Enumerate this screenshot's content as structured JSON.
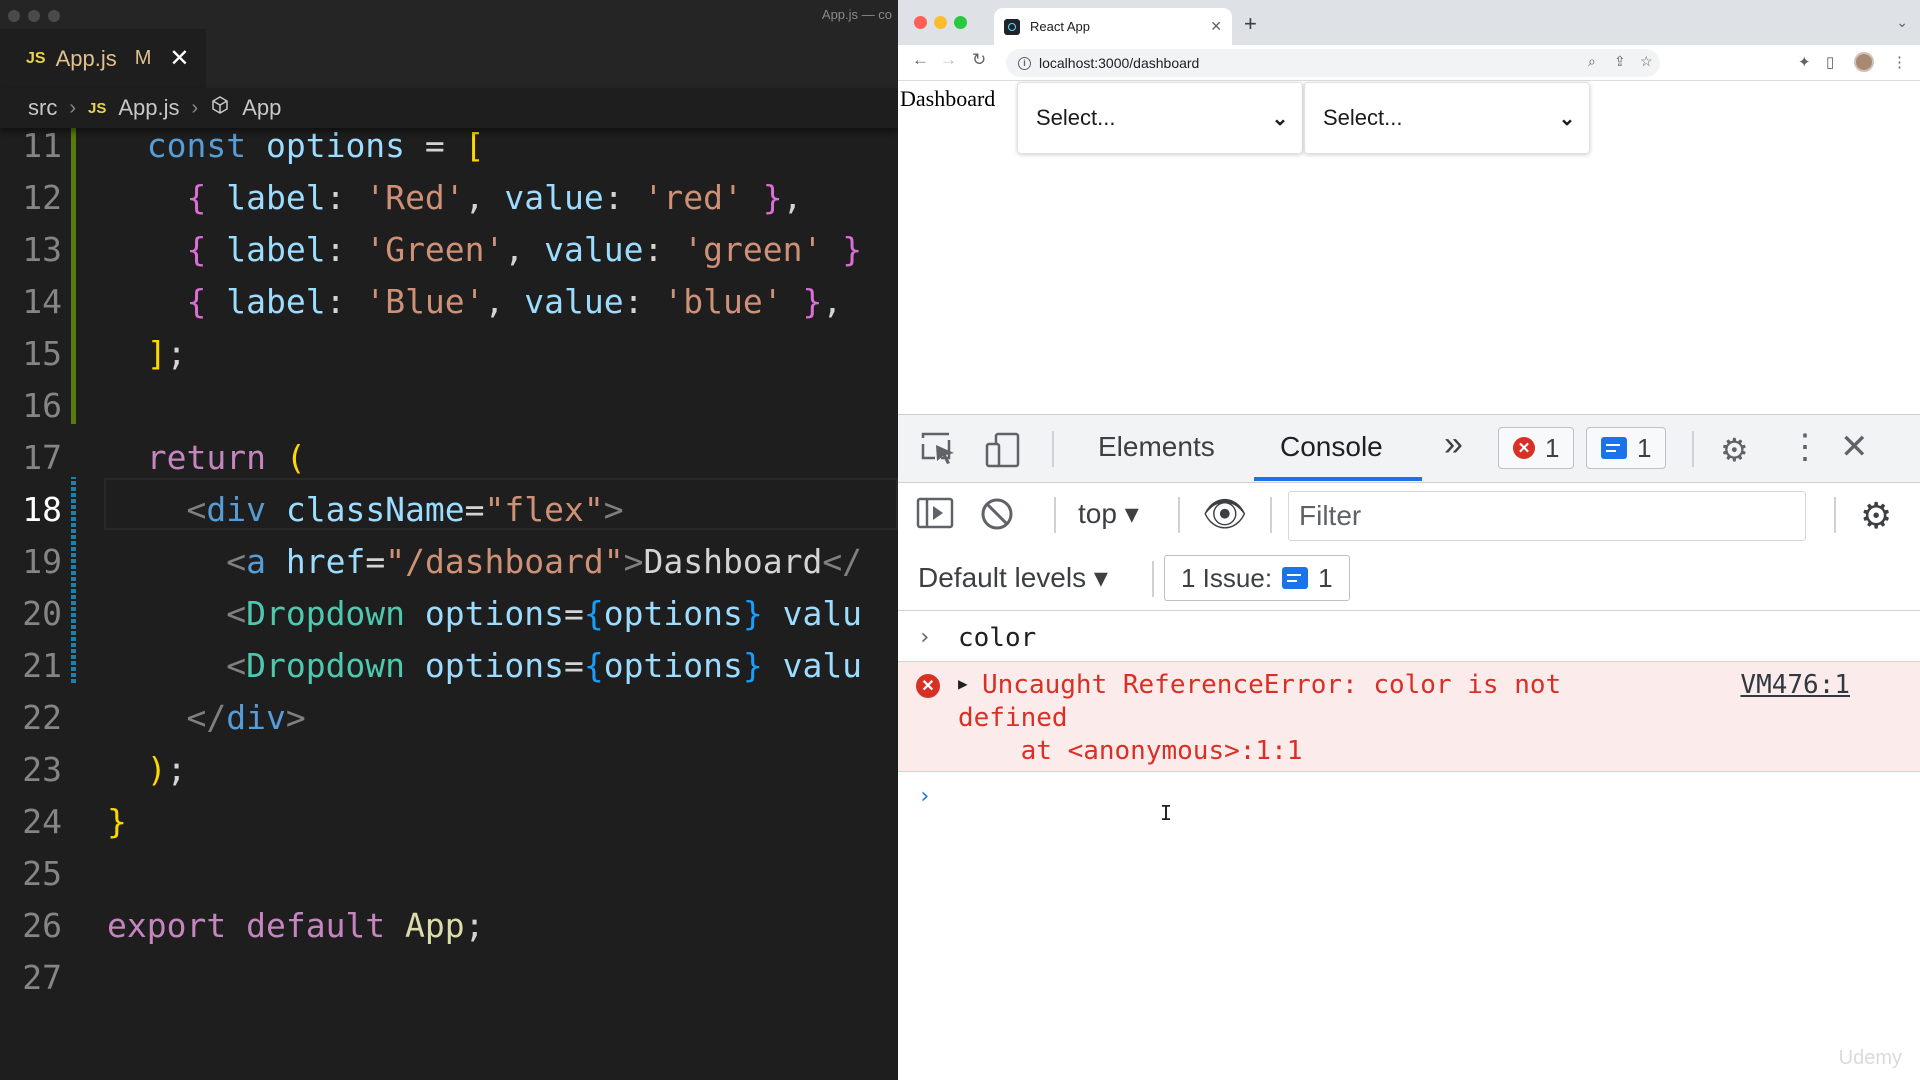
{
  "editor": {
    "window_title": "App.js — co",
    "tab": {
      "badge": "JS",
      "filename": "App.js",
      "status": "M",
      "close": "✕"
    },
    "breadcrumbs": {
      "folder": "src",
      "file_badge": "JS",
      "file": "App.js",
      "symbol": "App"
    },
    "current_line": 18,
    "lines": [
      {
        "n": "11",
        "parts": [
          [
            "p",
            "  "
          ],
          [
            "kb",
            "const"
          ],
          [
            "p",
            " "
          ],
          [
            "v",
            "options"
          ],
          [
            "p",
            " = "
          ],
          [
            "b1",
            "["
          ]
        ]
      },
      {
        "n": "12",
        "parts": [
          [
            "p",
            "    "
          ],
          [
            "b2",
            "{"
          ],
          [
            "p",
            " "
          ],
          [
            "v",
            "label"
          ],
          [
            "p",
            ": "
          ],
          [
            "s",
            "'Red'"
          ],
          [
            "p",
            ", "
          ],
          [
            "v",
            "value"
          ],
          [
            "p",
            ": "
          ],
          [
            "s",
            "'red'"
          ],
          [
            "p",
            " "
          ],
          [
            "b2",
            "}"
          ],
          [
            "p",
            ","
          ]
        ]
      },
      {
        "n": "13",
        "parts": [
          [
            "p",
            "    "
          ],
          [
            "b2",
            "{"
          ],
          [
            "p",
            " "
          ],
          [
            "v",
            "label"
          ],
          [
            "p",
            ": "
          ],
          [
            "s",
            "'Green'"
          ],
          [
            "p",
            ", "
          ],
          [
            "v",
            "value"
          ],
          [
            "p",
            ": "
          ],
          [
            "s",
            "'green'"
          ],
          [
            "p",
            " "
          ],
          [
            "b2",
            "}"
          ]
        ]
      },
      {
        "n": "14",
        "parts": [
          [
            "p",
            "    "
          ],
          [
            "b2",
            "{"
          ],
          [
            "p",
            " "
          ],
          [
            "v",
            "label"
          ],
          [
            "p",
            ": "
          ],
          [
            "s",
            "'Blue'"
          ],
          [
            "p",
            ", "
          ],
          [
            "v",
            "value"
          ],
          [
            "p",
            ": "
          ],
          [
            "s",
            "'blue'"
          ],
          [
            "p",
            " "
          ],
          [
            "b2",
            "}"
          ],
          [
            "p",
            ","
          ]
        ]
      },
      {
        "n": "15",
        "parts": [
          [
            "p",
            "  "
          ],
          [
            "b1",
            "]"
          ],
          [
            "p",
            ";"
          ]
        ]
      },
      {
        "n": "16",
        "parts": []
      },
      {
        "n": "17",
        "parts": [
          [
            "p",
            "  "
          ],
          [
            "k",
            "return"
          ],
          [
            "p",
            " "
          ],
          [
            "b1",
            "("
          ]
        ]
      },
      {
        "n": "18",
        "parts": [
          [
            "p",
            "    "
          ],
          [
            "tg",
            "<"
          ],
          [
            "tag",
            "div"
          ],
          [
            "p",
            " "
          ],
          [
            "attr",
            "className"
          ],
          [
            "p",
            "="
          ],
          [
            "s",
            "\"flex\""
          ],
          [
            "tg",
            ">"
          ]
        ]
      },
      {
        "n": "19",
        "parts": [
          [
            "p",
            "      "
          ],
          [
            "tg",
            "<"
          ],
          [
            "tag",
            "a"
          ],
          [
            "p",
            " "
          ],
          [
            "attr",
            "href"
          ],
          [
            "p",
            "="
          ],
          [
            "s",
            "\"/dashboard\""
          ],
          [
            "tg",
            ">"
          ],
          [
            "txt",
            "Dashboard"
          ],
          [
            "tg",
            "</"
          ]
        ]
      },
      {
        "n": "20",
        "parts": [
          [
            "p",
            "      "
          ],
          [
            "tg",
            "<"
          ],
          [
            "tagc",
            "Dropdown"
          ],
          [
            "p",
            " "
          ],
          [
            "attr",
            "options"
          ],
          [
            "p",
            "="
          ],
          [
            "b3",
            "{"
          ],
          [
            "v",
            "options"
          ],
          [
            "b3",
            "}"
          ],
          [
            "p",
            " "
          ],
          [
            "attr",
            "valu"
          ]
        ]
      },
      {
        "n": "21",
        "parts": [
          [
            "p",
            "      "
          ],
          [
            "tg",
            "<"
          ],
          [
            "tagc",
            "Dropdown"
          ],
          [
            "p",
            " "
          ],
          [
            "attr",
            "options"
          ],
          [
            "p",
            "="
          ],
          [
            "b3",
            "{"
          ],
          [
            "v",
            "options"
          ],
          [
            "b3",
            "}"
          ],
          [
            "p",
            " "
          ],
          [
            "attr",
            "valu"
          ]
        ]
      },
      {
        "n": "22",
        "parts": [
          [
            "p",
            "    "
          ],
          [
            "tg",
            "</"
          ],
          [
            "tag",
            "div"
          ],
          [
            "tg",
            ">"
          ]
        ]
      },
      {
        "n": "23",
        "parts": [
          [
            "p",
            "  "
          ],
          [
            "b1",
            ")"
          ],
          [
            "p",
            ";"
          ]
        ]
      },
      {
        "n": "24",
        "parts": [
          [
            "b1",
            "}"
          ]
        ]
      },
      {
        "n": "25",
        "parts": []
      },
      {
        "n": "26",
        "parts": [
          [
            "k",
            "export"
          ],
          [
            "p",
            " "
          ],
          [
            "k",
            "default"
          ],
          [
            "p",
            " "
          ],
          [
            "fn",
            "App"
          ],
          [
            "p",
            ";"
          ]
        ]
      },
      {
        "n": "27",
        "parts": []
      }
    ]
  },
  "browser": {
    "tab_title": "React App",
    "tab_close": "✕",
    "new_tab": "+",
    "url": "localhost:3000/dashboard",
    "page": {
      "link": "Dashboard",
      "select1": "Select...",
      "select2": "Select..."
    }
  },
  "devtools": {
    "tabs": {
      "elements": "Elements",
      "console": "Console",
      "more": "»"
    },
    "error_count": "1",
    "message_count": "1",
    "context": "top",
    "filter_placeholder": "Filter",
    "levels": "Default levels",
    "issues": {
      "label": "1 Issue:",
      "count": "1"
    },
    "console": {
      "input": "color",
      "error_line1": "Uncaught ReferenceError: color is not",
      "error_line2": "defined",
      "error_line3": "    at <anonymous>:1:1",
      "error_source": "VM476:1"
    },
    "watermark": "Udemy"
  },
  "colors": {
    "editor_bg": "#1e1e1e",
    "error_red": "#d93025",
    "devtools_blue": "#1a73e8"
  }
}
